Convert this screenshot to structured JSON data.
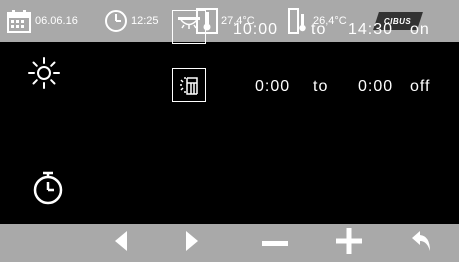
{
  "statusbar": {
    "date": "06.06.16",
    "time": "12:25",
    "temp_inside": "27,4°C",
    "temp_outside": "26,4°C",
    "brand": "CIBUS",
    "icons": [
      "calendar-icon",
      "clock-icon",
      "thermometer-icon",
      "thermometer-window-icon"
    ]
  },
  "sidebar": {
    "icons": [
      "sun-icon",
      "timer-icon"
    ]
  },
  "schedule": [
    {
      "mode_icon": "awning-sun-icon",
      "start": "10:00",
      "to": "to",
      "end": "14:30",
      "state": "on"
    },
    {
      "mode_icon": "window-sun-icon",
      "start": "0:00",
      "to": "to",
      "end": "0:00",
      "state": "off"
    }
  ],
  "navbar": {
    "buttons": [
      "prev-icon",
      "next-icon",
      "minus-icon",
      "plus-icon",
      "back-icon"
    ]
  },
  "colors": {
    "bar_background": "#a9a9a9",
    "screen_background": "#000000",
    "foreground": "#ffffff"
  }
}
